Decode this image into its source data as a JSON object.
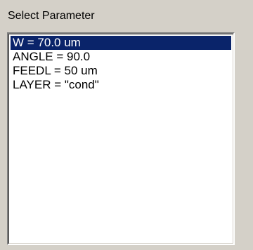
{
  "panel": {
    "title": "Select Parameter"
  },
  "list": {
    "items": [
      {
        "label": "W = 70.0 um",
        "selected": true
      },
      {
        "label": "ANGLE = 90.0",
        "selected": false
      },
      {
        "label": "FEEDL = 50 um",
        "selected": false
      },
      {
        "label": "LAYER = \"cond\"",
        "selected": false
      }
    ],
    "selected_background": "#0a246a",
    "selected_text_color": "#ffffff"
  }
}
